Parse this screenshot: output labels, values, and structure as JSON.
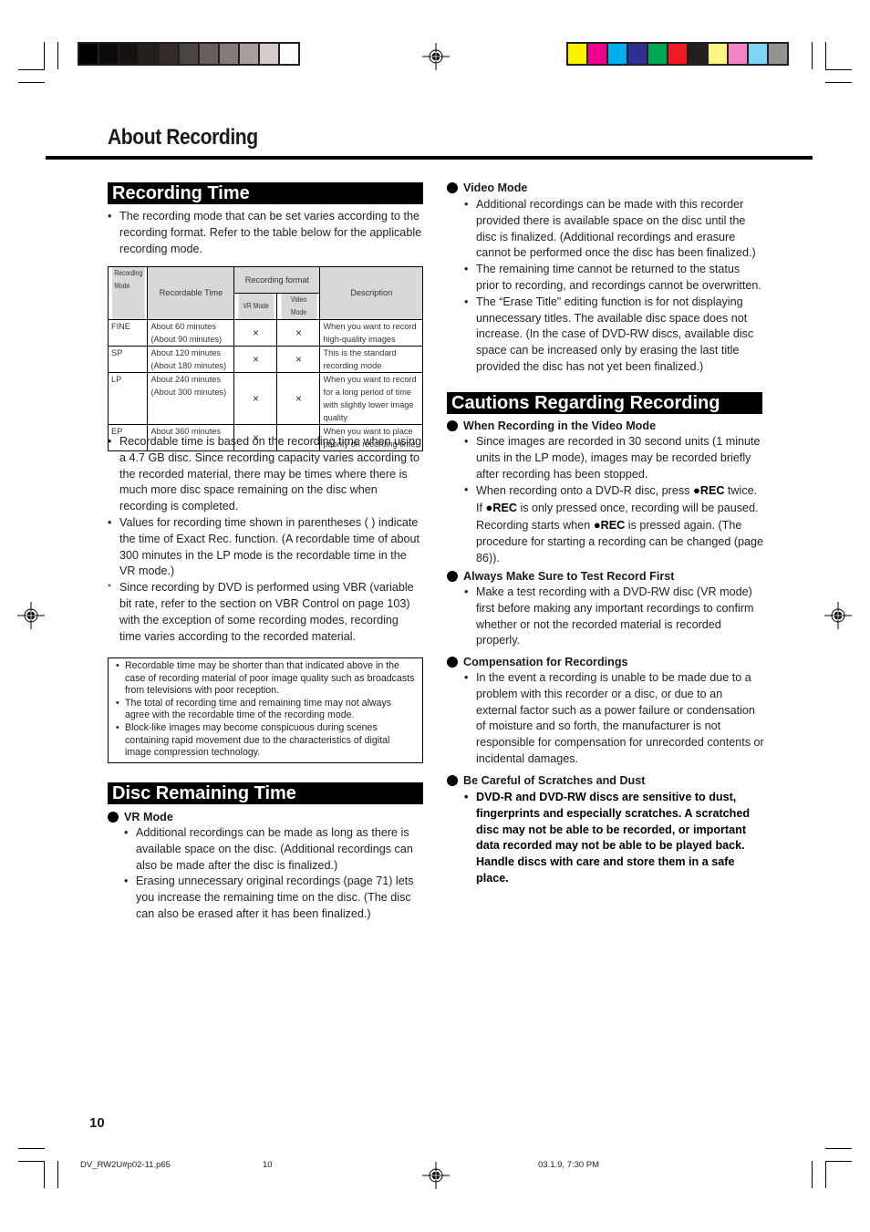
{
  "print_marks": {
    "gray_swatches": [
      "#000000",
      "#0c0a09",
      "#161212",
      "#231f1d",
      "#352b2a",
      "#4c4443",
      "#695e5c",
      "#877b79",
      "#a89e9c",
      "#d5cbca",
      "#ffffff"
    ],
    "color_swatches": [
      "#fff200",
      "#ec008c",
      "#00aeef",
      "#2e3192",
      "#00a651",
      "#ed1c24",
      "#231f20",
      "#fff685",
      "#f285c6",
      "#7fd3f7",
      "#939191"
    ]
  },
  "page": {
    "title": "About Recording",
    "page_number": "10"
  },
  "recording_time": {
    "heading": "Recording Time",
    "intro": "The recording mode that can be set varies according to the recording format. Refer to the table below for the applicable recording mode.",
    "table": {
      "headers": {
        "mode": "Recording Mode",
        "time": "Recordable Time",
        "format": "Recording format",
        "vr": "VR Mode",
        "video": "Video Mode",
        "desc": "Description"
      },
      "rows": [
        {
          "mode": "FINE",
          "time1": "About 60 minutes",
          "time2": "(About 90 minutes)",
          "vr": "×",
          "video": "×",
          "desc": "When you want to record high-quality images"
        },
        {
          "mode": "SP",
          "time1": "About 120 minutes",
          "time2": "(About 180 minutes)",
          "vr": "×",
          "video": "×",
          "desc": "This is the standard recording mode"
        },
        {
          "mode": "LP",
          "time1": "About 240 minutes",
          "time2": "(About 300 minutes)",
          "vr": "×",
          "video": "×",
          "desc": "When you want to record for a long period of time with slightly lower image quality"
        },
        {
          "mode": "EP",
          "time1": "About 360 minutes",
          "time2": "",
          "vr": "×",
          "video": "",
          "desc": "When you want to place priority on recording time"
        }
      ]
    },
    "bullets": [
      "Recordable time is based on the recording time when using a 4.7 GB disc. Since recording capacity varies according to the recorded material, there may be times where there is much more disc space remaining on the disc when recording is completed.",
      "Values for recording time shown in parentheses (  ) indicate the time of Exact Rec. function. (A recordable time of about 300 minutes in the LP mode is the recordable time in the VR mode.)"
    ],
    "footnote": "Since recording by DVD is performed using VBR (variable bit rate, refer to the section on VBR Control on page 103) with the exception of some recording modes, recording time varies according to the recorded material.",
    "notes": [
      "Recordable time may be shorter than that indicated above in the case of recording material of poor image quality such as broadcasts from televisions with poor reception.",
      "The total of recording time and remaining time may not always agree with the recordable time of the recording mode.",
      "Block-like images may become conspicuous during scenes containing rapid movement due to the characteristics of digital image compression technology."
    ]
  },
  "disc_remaining": {
    "heading": "Disc Remaining Time",
    "vr_title": "VR Mode",
    "vr_bullets": [
      "Additional recordings can be made as long as there is available space on the disc. (Additional recordings can also be made after the disc is finalized.)",
      "Erasing unnecessary original recordings (page 71) lets you increase the remaining time on the disc. (The disc can also be erased after it has been finalized.)"
    ],
    "video_title": "Video Mode",
    "video_bullets": [
      "Additional recordings can be made with this recorder provided there is available space on the disc until the disc is finalized. (Additional recordings and erasure cannot be performed once the disc has been finalized.)",
      "The remaining time cannot be returned to the status prior to recording, and recordings cannot be overwritten.",
      "The “Erase Title” editing function is for not displaying unnecessary titles. The available disc space does not increase. (In the case of DVD-RW discs, available disc space can be increased only by erasing the last title provided the disc has not yet been finalized.)"
    ]
  },
  "cautions": {
    "heading": "Cautions Regarding Recording",
    "video_mode_title": "When Recording in the Video Mode",
    "video_mode_b1": "Since images are recorded in 30 second units (1 minute units in the LP mode), images may be recorded briefly after recording has been stopped.",
    "video_mode_b2": {
      "p1": "When recording onto a DVD-R disc, press ",
      "rec": "REC",
      "p2": " twice. If ",
      "p3": " is only pressed once, recording will be paused. Recording starts when ",
      "p4": " is pressed again. (The procedure for starting a recording can be changed (page 86))."
    },
    "test_title": "Always Make Sure to Test Record First",
    "test_b1": "Make a test recording with a DVD-RW disc (VR mode) first before making any important recordings to confirm whether or not the recorded material is recorded properly.",
    "comp_title": "Compensation for Recordings",
    "comp_b1": "In the event a recording is unable to be made due to a problem with this recorder or a disc, or due to an external factor such as a power failure or condensation of moisture and so forth, the manufacturer is not responsible for compensation for unrecorded contents or incidental damages.",
    "scratch_title": "Be Careful of Scratches and Dust",
    "scratch_b1": "DVD-R and DVD-RW discs are sensitive to dust, fingerprints and especially scratches. A scratched disc may not be able to be recorded, or important data recorded may not be able to be played back. Handle discs with care and store them in a safe place."
  },
  "footer": {
    "file": "DV_RW2U#p02-11.p65",
    "page": "10",
    "date": "03.1.9, 7:30 PM"
  }
}
